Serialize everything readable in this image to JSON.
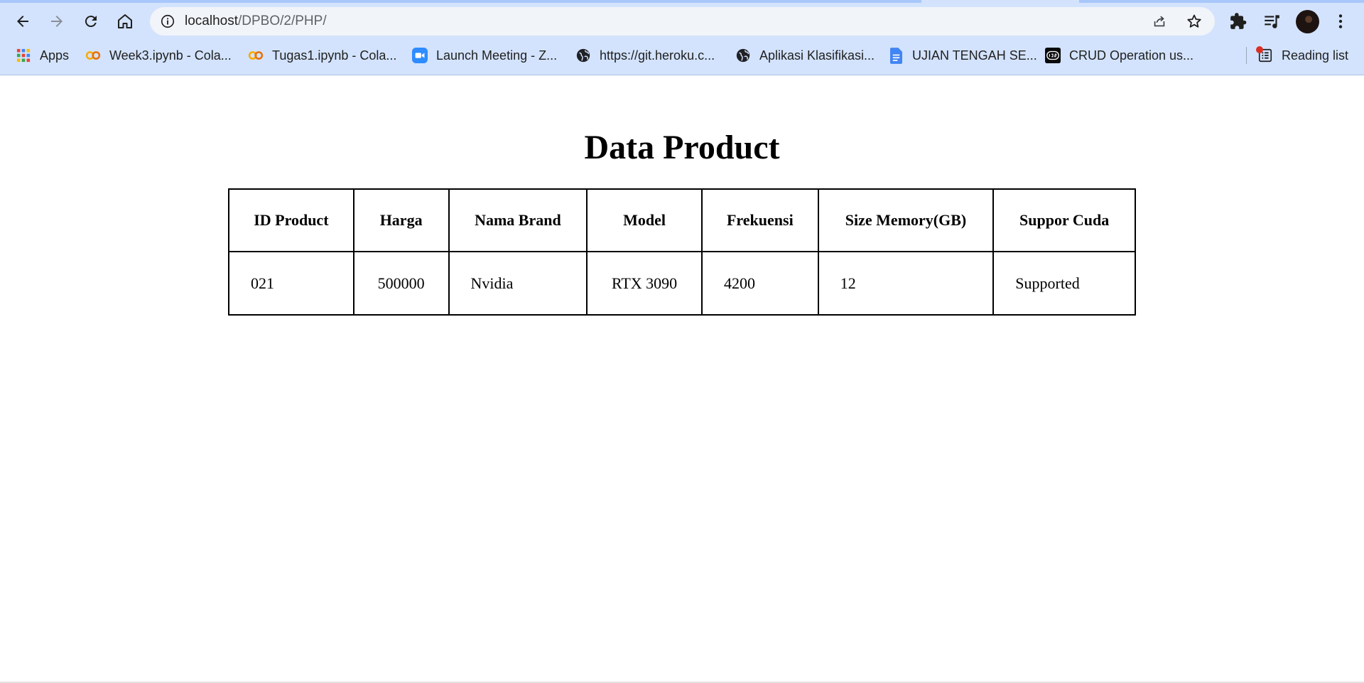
{
  "browser": {
    "url_host": "localhost",
    "url_path": "/DPBO/2/PHP/",
    "bookmarks": [
      {
        "label": "Apps",
        "icon": "apps-grid-icon"
      },
      {
        "label": "Week3.ipynb - Cola...",
        "icon": "colab-icon"
      },
      {
        "label": "Tugas1.ipynb - Cola...",
        "icon": "colab-icon"
      },
      {
        "label": "Launch Meeting - Z...",
        "icon": "zoom-icon"
      },
      {
        "label": "https://git.heroku.c...",
        "icon": "globe-icon"
      },
      {
        "label": "Aplikasi Klasifikasi...",
        "icon": "globe-icon"
      },
      {
        "label": "UJIAN TENGAH SE...",
        "icon": "docs-icon"
      },
      {
        "label": "CRUD Operation us...",
        "icon": "dev-icon"
      }
    ],
    "reading_list_label": "Reading list",
    "colors": {
      "chrome": "#d3e3fd",
      "omnibox": "#f1f4f9"
    }
  },
  "page": {
    "title": "Data Product",
    "table": {
      "headers": [
        "ID Product",
        "Harga",
        "Nama Brand",
        "Model",
        "Frekuensi",
        "Size Memory(GB)",
        "Suppor Cuda"
      ],
      "rows": [
        [
          "021",
          "500000",
          "Nvidia",
          "RTX 3090",
          "4200",
          "12",
          "Supported"
        ]
      ]
    }
  }
}
